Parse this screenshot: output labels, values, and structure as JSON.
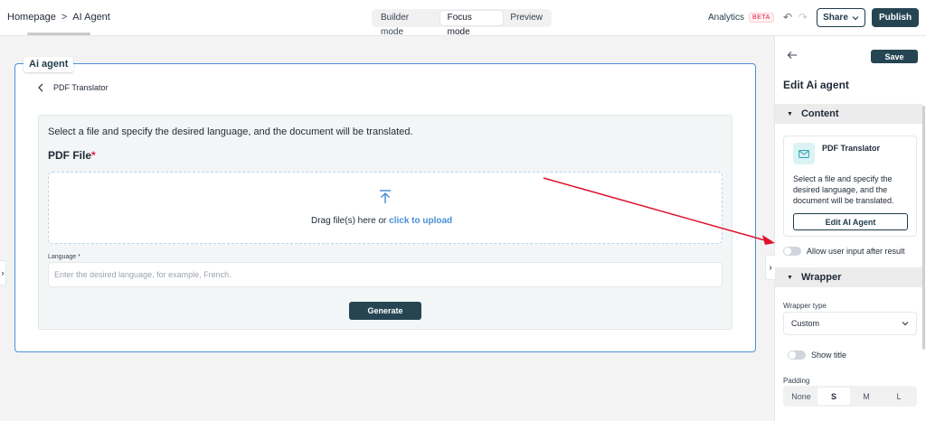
{
  "topbar": {
    "breadcrumb": [
      "Homepage",
      "AI Agent"
    ],
    "breadcrumb_sep": ">",
    "modes": [
      {
        "label": "Builder mode",
        "active": false
      },
      {
        "label": "Focus mode",
        "active": true
      },
      {
        "label": "Preview",
        "active": false
      }
    ],
    "analytics_label": "Analytics",
    "beta_badge": "BETA",
    "share_label": "Share",
    "publish_label": "Publish"
  },
  "canvas": {
    "frame_tag": "Ai agent",
    "agent_name": "PDF Translator",
    "intro": "Select a file and specify the desired language, and the document will be translated.",
    "file_label": "PDF File",
    "required_mark": "*",
    "drag_text": "Drag file(s) here or ",
    "upload_link": "click to upload",
    "language_label": "Language *",
    "language_placeholder": "Enter the desired language, for example, French.",
    "generate_label": "Generate"
  },
  "panel": {
    "save_label": "Save",
    "title": "Edit Ai agent",
    "content_section": "Content",
    "card_title": "PDF Translator",
    "card_desc": "Select a file and specify the desired language, and the document will be translated.",
    "edit_agent_label": "Edit AI Agent",
    "allow_input_label": "Allow user input after result",
    "allow_input_on": false,
    "wrapper_section": "Wrapper",
    "wrapper_type_label": "Wrapper type",
    "wrapper_type_value": "Custom",
    "show_title_label": "Show title",
    "show_title_on": false,
    "padding_label": "Padding",
    "padding_options": [
      {
        "label": "None",
        "active": false
      },
      {
        "label": "S",
        "active": true
      },
      {
        "label": "M",
        "active": false
      },
      {
        "label": "L",
        "active": false
      }
    ]
  },
  "colors": {
    "primary": "#264553",
    "frame_border": "#4a90d9",
    "annotation_arrow": "#e0112b",
    "beta": "#e11d48"
  },
  "icons": {
    "upload": "arrow-up-to-line-icon",
    "mail": "envelope-icon",
    "back": "chevron-left-icon",
    "panel_back": "arrow-left-icon"
  }
}
